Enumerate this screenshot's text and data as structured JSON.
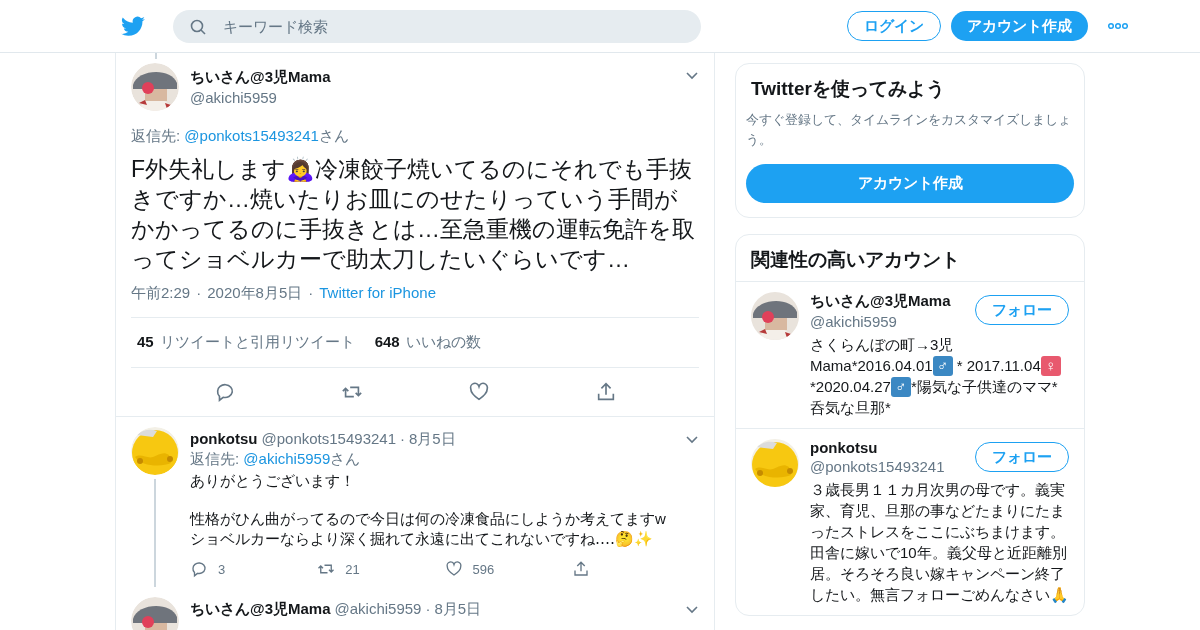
{
  "header": {
    "search": {
      "placeholder": "キーワード検索"
    },
    "login": "ログイン",
    "signup": "アカウント作成"
  },
  "main_tweet": {
    "name": "ちいさん@3児Mama",
    "handle": "@akichi5959",
    "reply_label": "返信先: ",
    "reply_to": "@ponkots15493241",
    "reply_suffix": "さん",
    "text": "F外失礼します🙇‍♀️冷凍餃子焼いてるのにそれでも手抜きですか…焼いたりお皿にのせたりっていう手間がかかってるのに手抜きとは…至急重機の運転免許を取ってショベルカーで助太刀したいぐらいです…",
    "meta": [
      {
        "kind": "text",
        "text": "午前2:29"
      },
      {
        "kind": "sep",
        "text": "·"
      },
      {
        "kind": "text",
        "text": "2020年8月5日"
      },
      {
        "kind": "sep",
        "text": "·"
      },
      {
        "kind": "link",
        "text": "Twitter for iPhone"
      }
    ],
    "stats": [
      {
        "count": "45",
        "label": "リツイートと引用リツイート"
      },
      {
        "count": "648",
        "label": "いいねの数"
      }
    ],
    "actions": [
      {
        "kind": "reply"
      },
      {
        "kind": "retweet"
      },
      {
        "kind": "like"
      },
      {
        "kind": "share"
      }
    ]
  },
  "replies": [
    {
      "name": "ponkotsu",
      "handle": "@ponkots15493241",
      "sep": "·",
      "date": "8月5日",
      "reply_label": "返信先: ",
      "reply_to": "@akichi5959",
      "reply_suffix": "さん",
      "paragraphs": [
        [
          "ありがとうございます！"
        ],
        [
          "性格がひん曲がってるので今日は何の冷凍食品にしようか考えてますw",
          "ショベルカーならより深く掘れて永遠に出てこれないですね‥‥🤔✨"
        ]
      ],
      "thread": true,
      "actions": [
        {
          "kind": "reply",
          "count": "3"
        },
        {
          "kind": "retweet",
          "count": "21"
        },
        {
          "kind": "like",
          "count": "596"
        },
        {
          "kind": "share"
        }
      ]
    },
    {
      "name": "ちいさん@3児Mama",
      "handle": "@akichi5959",
      "sep": "·",
      "date": "8月5日",
      "thread": false
    }
  ],
  "sidebar": {
    "signup_card": {
      "title": "Twitterを使ってみよう",
      "text": "今すぐ登録して、タイムラインをカスタマイズしましょう。",
      "button": "アカウント作成"
    },
    "related": {
      "title": "関連性の高いアカウント",
      "accounts": [
        {
          "name": "ちいさん@3児Mama",
          "handle": "@akichi5959",
          "button": "フォロー",
          "bio": [
            {
              "kind": "text",
              "text": "さくらんぼの町→3児Mama*2016.04.01"
            },
            {
              "kind": "sign",
              "text": "♂",
              "color": "#3b88c3"
            },
            {
              "kind": "text",
              "text": " * 2017.11.04"
            },
            {
              "kind": "sign",
              "text": "♀",
              "color": "#e8596e"
            },
            {
              "kind": "text",
              "text": " *2020.04.27"
            },
            {
              "kind": "sign",
              "text": "♂",
              "color": "#3b88c3"
            },
            {
              "kind": "text",
              "text": "*陽気な子供達のママ*呑気な旦那*"
            }
          ]
        },
        {
          "name": "ponkotsu",
          "handle": "@ponkots15493241",
          "button": "フォロー",
          "bio": [
            {
              "kind": "text",
              "text": "３歳長男１１カ月次男の母です。義実家、育児、旦那の事などたまりにたまったストレスをここにぶちまけます。田舎に嫁いで10年。義父母と近距離別居。そろそろ良い嫁キャンペーン終了したい。無言フォローごめんなさい🙏"
            }
          ]
        }
      ]
    }
  }
}
